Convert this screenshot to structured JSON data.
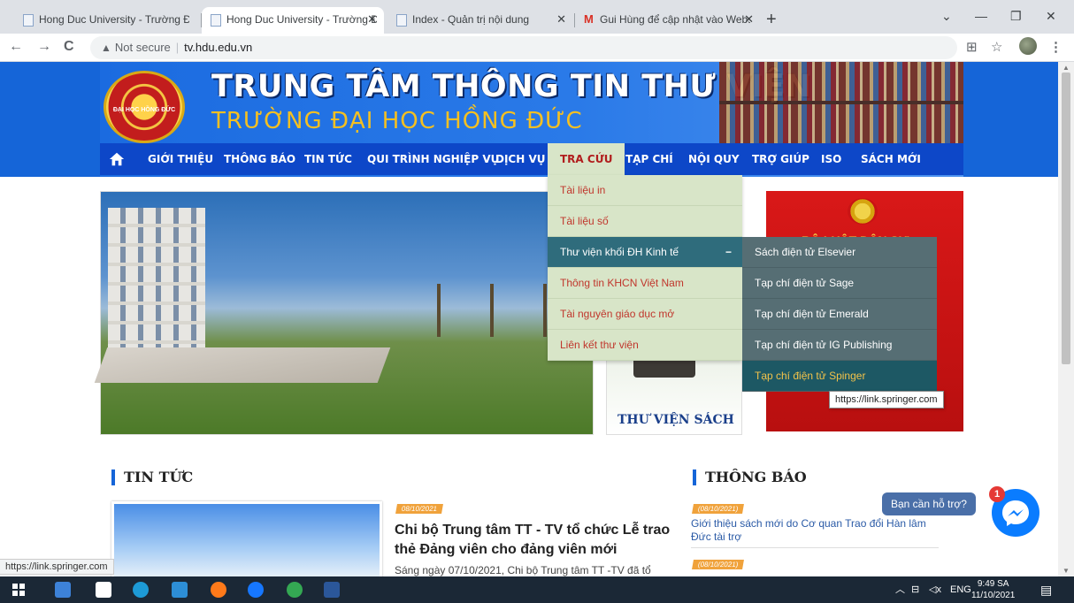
{
  "browser": {
    "tabs": [
      {
        "title": "Hong Duc University - Trường Đạ",
        "active": false
      },
      {
        "title": "Hong Duc University - Trường Đạ",
        "active": true
      },
      {
        "title": "Index - Quản trị nội dung",
        "active": false
      },
      {
        "title": "Gui Hùng để cập nhật vào Websi",
        "active": false
      }
    ],
    "new_tab": "+",
    "security_label": "Not secure",
    "url": "tv.hdu.edu.vn"
  },
  "site": {
    "logo_text": "ĐẠI HỌC HỒNG ĐỨC",
    "title": "TRUNG TÂM THÔNG TIN THƯ VIỆN",
    "subtitle": "TRƯỜNG ĐẠI HỌC HỒNG ĐỨC"
  },
  "nav": {
    "items": [
      {
        "label": "GIỚI THIỆU"
      },
      {
        "label": "THÔNG BÁO"
      },
      {
        "label": "TIN TỨC"
      },
      {
        "label": "QUI TRÌNH NGHIỆP VỤ"
      },
      {
        "label": "DỊCH VỤ"
      },
      {
        "label": "TRA CỨU",
        "active": true
      },
      {
        "label": "TẠP CHÍ"
      },
      {
        "label": "NỘI QUY"
      },
      {
        "label": "TRỢ GIÚP"
      },
      {
        "label": "ISO"
      },
      {
        "label": "SÁCH MỚI"
      }
    ]
  },
  "dropdown": {
    "items": [
      {
        "label": "Tài liệu in"
      },
      {
        "label": "Tài liệu số"
      },
      {
        "label": "Thư viện khối ĐH Kinh tế",
        "toggle": "−"
      },
      {
        "label": "Thông tin KHCN Việt Nam"
      },
      {
        "label": "Tài nguyên giáo dục mở"
      },
      {
        "label": "Liên kết thư viện"
      }
    ],
    "submenu": [
      {
        "label": "Sách điện tử Elsevier"
      },
      {
        "label": "Tạp chí điện tử Sage"
      },
      {
        "label": "Tạp chí điện tử Emerald"
      },
      {
        "label": "Tạp chí điện tử IG Publishing"
      },
      {
        "label": "Tạp chí điện tử Spinger"
      }
    ],
    "tooltip": "https://link.springer.com"
  },
  "side_cards": {
    "book_label": "THƯ VIỆN SÁCH",
    "law_title": "BỘ LUẬT DÂN SỰ"
  },
  "news": {
    "heading": "TIN TỨC",
    "date": "08/10/2021",
    "title": "Chi bộ Trung tâm TT - TV tổ chức Lễ trao thẻ Đảng viên cho đảng viên mới",
    "excerpt": "Sáng ngày 07/10/2021, Chi bộ Trung tâm TT -TV đã tổ"
  },
  "notices": {
    "heading": "THÔNG BÁO",
    "items": [
      {
        "date": "(08/10/2021)",
        "text": "Giới thiệu sách mới do Cơ quan Trao đổi Hàn lâm Đức tài trợ"
      },
      {
        "date": "(08/10/2021)",
        "text": ""
      }
    ]
  },
  "chat": {
    "help_text": "Bạn cần hỗ trợ?",
    "badge": "1"
  },
  "status_url": "https://link.springer.com",
  "taskbar": {
    "lang": "ENG",
    "time": "9:49 SA",
    "date": "11/10/2021"
  },
  "colors": {
    "banner": "#1565d8",
    "nav": "#0d47c8",
    "dropdown_bg": "#d8e5c8",
    "dropdown_text": "#c0362c",
    "submenu_bg": "#566e74",
    "accent": "#f5c021"
  }
}
